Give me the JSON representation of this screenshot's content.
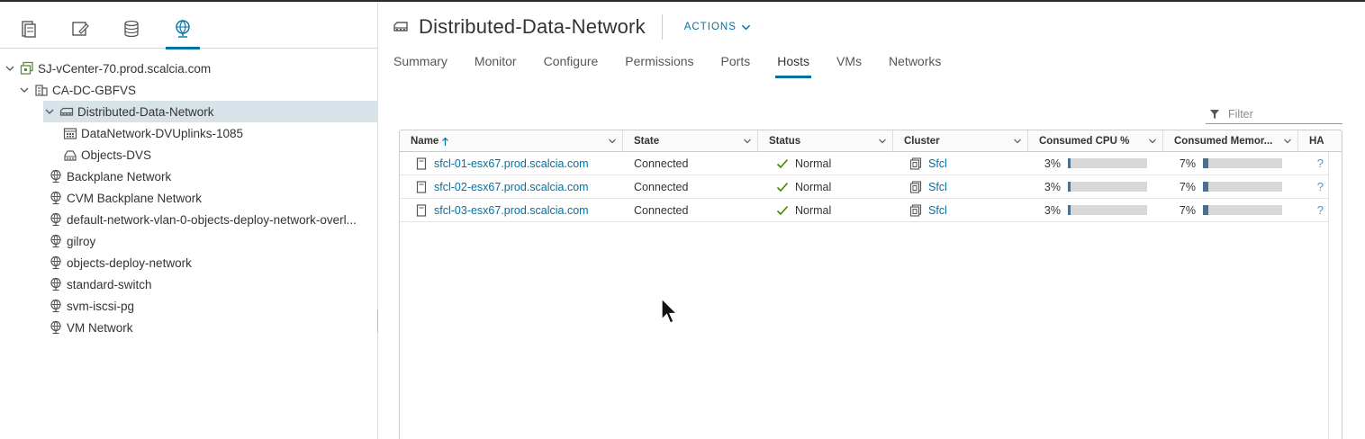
{
  "navigator": {
    "tabs": [
      {
        "name": "hosts-and-clusters",
        "active": false
      },
      {
        "name": "vms-and-templates",
        "active": false
      },
      {
        "name": "storage",
        "active": false
      },
      {
        "name": "networking",
        "active": true
      }
    ],
    "tree": [
      {
        "label": "SJ-vCenter-70.prod.scalcia.com",
        "icon": "vcenter-icon",
        "expanded": true,
        "level": 0
      },
      {
        "label": "CA-DC-GBFVS",
        "icon": "datacenter-icon",
        "expanded": true,
        "level": 1
      },
      {
        "label": "Distributed-Data-Network",
        "icon": "distributed-switch-icon",
        "expanded": true,
        "level": 2,
        "selected": true
      },
      {
        "label": "DataNetwork-DVUplinks-1085",
        "icon": "uplink-portgroup-icon",
        "level": 3
      },
      {
        "label": "Objects-DVS",
        "icon": "distributed-portgroup-icon",
        "level": 3
      },
      {
        "label": "Backplane Network",
        "icon": "network-icon",
        "level": 2
      },
      {
        "label": "CVM Backplane Network",
        "icon": "network-icon",
        "level": 2
      },
      {
        "label": "default-network-vlan-0-objects-deploy-network-overl...",
        "icon": "network-icon",
        "level": 2
      },
      {
        "label": "gilroy",
        "icon": "network-icon",
        "level": 2
      },
      {
        "label": "objects-deploy-network",
        "icon": "network-icon",
        "level": 2
      },
      {
        "label": "standard-switch",
        "icon": "network-icon",
        "level": 2
      },
      {
        "label": "svm-iscsi-pg",
        "icon": "network-icon",
        "level": 2
      },
      {
        "label": "VM Network",
        "icon": "network-icon",
        "level": 2
      }
    ]
  },
  "header": {
    "title": "Distributed-Data-Network",
    "actions_label": "ACTIONS"
  },
  "tabs": [
    {
      "label": "Summary",
      "active": false
    },
    {
      "label": "Monitor",
      "active": false
    },
    {
      "label": "Configure",
      "active": false
    },
    {
      "label": "Permissions",
      "active": false
    },
    {
      "label": "Ports",
      "active": false
    },
    {
      "label": "Hosts",
      "active": true
    },
    {
      "label": "VMs",
      "active": false
    },
    {
      "label": "Networks",
      "active": false
    }
  ],
  "filter": {
    "placeholder": "Filter",
    "value": ""
  },
  "grid": {
    "columns": [
      {
        "label": "Name",
        "sorted": "ascending"
      },
      {
        "label": "State"
      },
      {
        "label": "Status"
      },
      {
        "label": "Cluster"
      },
      {
        "label": "Consumed CPU %"
      },
      {
        "label": "Consumed Memor..."
      },
      {
        "label": "HA"
      }
    ],
    "rows": [
      {
        "name": "sfcl-01-esx67.prod.scalcia.com",
        "state": "Connected",
        "status": "Normal",
        "cluster": "Sfcl",
        "cpu_text": "3%",
        "cpu": 3,
        "mem_text": "7%",
        "mem": 7,
        "ha": "?"
      },
      {
        "name": "sfcl-02-esx67.prod.scalcia.com",
        "state": "Connected",
        "status": "Normal",
        "cluster": "Sfcl",
        "cpu_text": "3%",
        "cpu": 3,
        "mem_text": "7%",
        "mem": 7,
        "ha": "?"
      },
      {
        "name": "sfcl-03-esx67.prod.scalcia.com",
        "state": "Connected",
        "status": "Normal",
        "cluster": "Sfcl",
        "cpu_text": "3%",
        "cpu": 3,
        "mem_text": "7%",
        "mem": 7,
        "ha": "?"
      }
    ]
  },
  "colors": {
    "accent": "#0072a3",
    "status_ok": "#3c8500",
    "bar_fill": "#4a6f8f"
  }
}
